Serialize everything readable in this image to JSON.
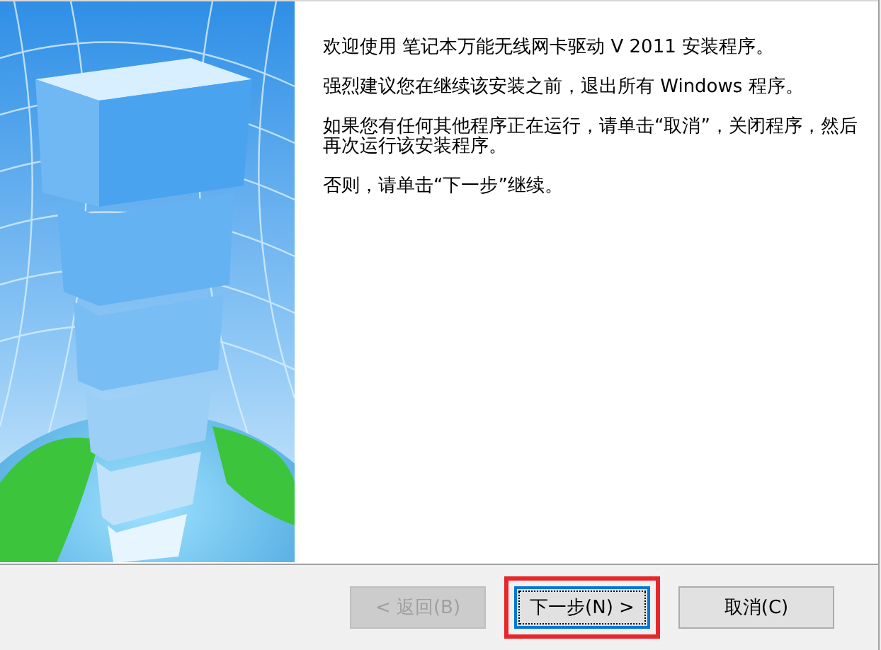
{
  "welcome": {
    "paragraphs": [
      "欢迎使用 笔记本万能无线网卡驱动 V 2011 安装程序。",
      "强烈建议您在继续该安装之前，退出所有 Windows 程序。",
      "如果您有任何其他程序正在运行，请单击“取消”，关闭程序，然后再次运行该安装程序。",
      "否则，请单击“下一步”继续。"
    ]
  },
  "buttons": [
    {
      "label": "< 返回(B)",
      "disabled": true,
      "focused": false,
      "highlighted": false
    },
    {
      "label": "下一步(N) >",
      "disabled": false,
      "focused": true,
      "highlighted": true
    },
    {
      "label": "取消(C)",
      "disabled": false,
      "focused": false,
      "highlighted": false
    }
  ]
}
